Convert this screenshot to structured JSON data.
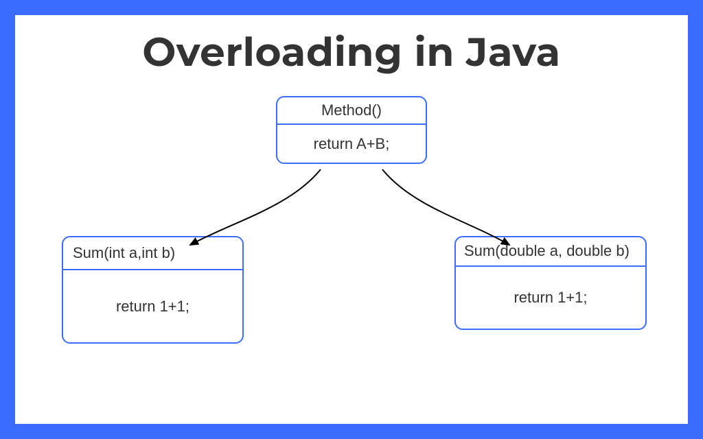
{
  "title": "Overloading in Java",
  "colors": {
    "frame": "#3a6cff",
    "box_border": "#3a6cff",
    "text": "#333333",
    "arrow": "#000000"
  },
  "diagram": {
    "parent": {
      "header": "Method()",
      "body": "return A+B;"
    },
    "children": [
      {
        "header": "Sum(int a,int b)",
        "body": "return 1+1;"
      },
      {
        "header": "Sum(double a, double b)",
        "body": "return 1+1;"
      }
    ]
  }
}
